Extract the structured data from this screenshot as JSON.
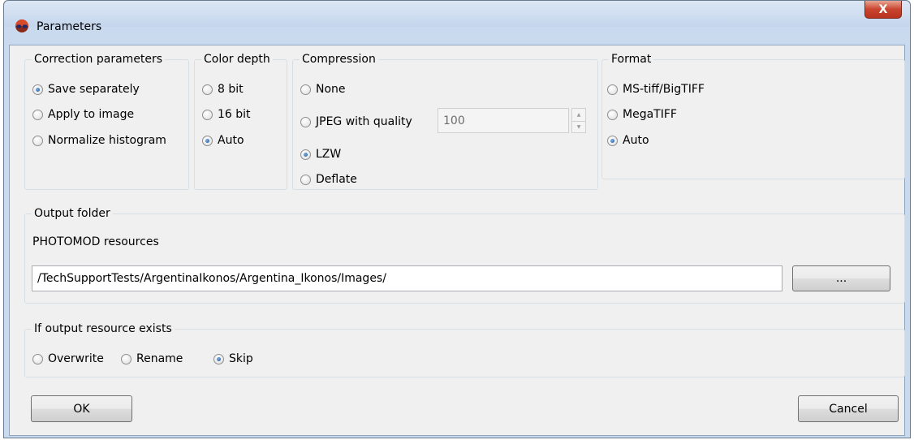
{
  "window": {
    "title": "Parameters",
    "close_label": "X"
  },
  "correction": {
    "legend": "Correction parameters",
    "options": [
      {
        "label": "Save separately",
        "checked": true
      },
      {
        "label": "Apply to image",
        "checked": false
      },
      {
        "label": "Normalize histogram",
        "checked": false
      }
    ]
  },
  "color_depth": {
    "legend": "Color depth",
    "options": [
      {
        "label": "8 bit",
        "checked": false
      },
      {
        "label": "16 bit",
        "checked": false
      },
      {
        "label": "Auto",
        "checked": true
      }
    ]
  },
  "compression": {
    "legend": "Compression",
    "options": [
      {
        "label": "None",
        "checked": false
      },
      {
        "label": "JPEG with quality",
        "checked": false
      },
      {
        "label": "LZW",
        "checked": true
      },
      {
        "label": "Deflate",
        "checked": false
      }
    ],
    "jpeg_quality": "100"
  },
  "format": {
    "legend": "Format",
    "options": [
      {
        "label": "MS-tiff/BigTIFF",
        "checked": false
      },
      {
        "label": "MegaTIFF",
        "checked": false
      },
      {
        "label": "Auto",
        "checked": true
      }
    ]
  },
  "output_folder": {
    "legend": "Output folder",
    "resource_label": "PHOTOMOD resources",
    "path": "/TechSupportTests/ArgentinaIkonos/Argentina_Ikonos/Images/",
    "browse_label": "..."
  },
  "exists": {
    "legend": "If output resource exists",
    "options": [
      {
        "label": "Overwrite",
        "checked": false
      },
      {
        "label": "Rename",
        "checked": false
      },
      {
        "label": "Skip",
        "checked": true
      }
    ]
  },
  "buttons": {
    "ok": "OK",
    "cancel": "Cancel"
  },
  "colors": {
    "titlebar": "#c9daee",
    "close_button": "#c9452f",
    "dialog_bg": "#f0f0f0",
    "radio_selected": "#1c5096"
  }
}
